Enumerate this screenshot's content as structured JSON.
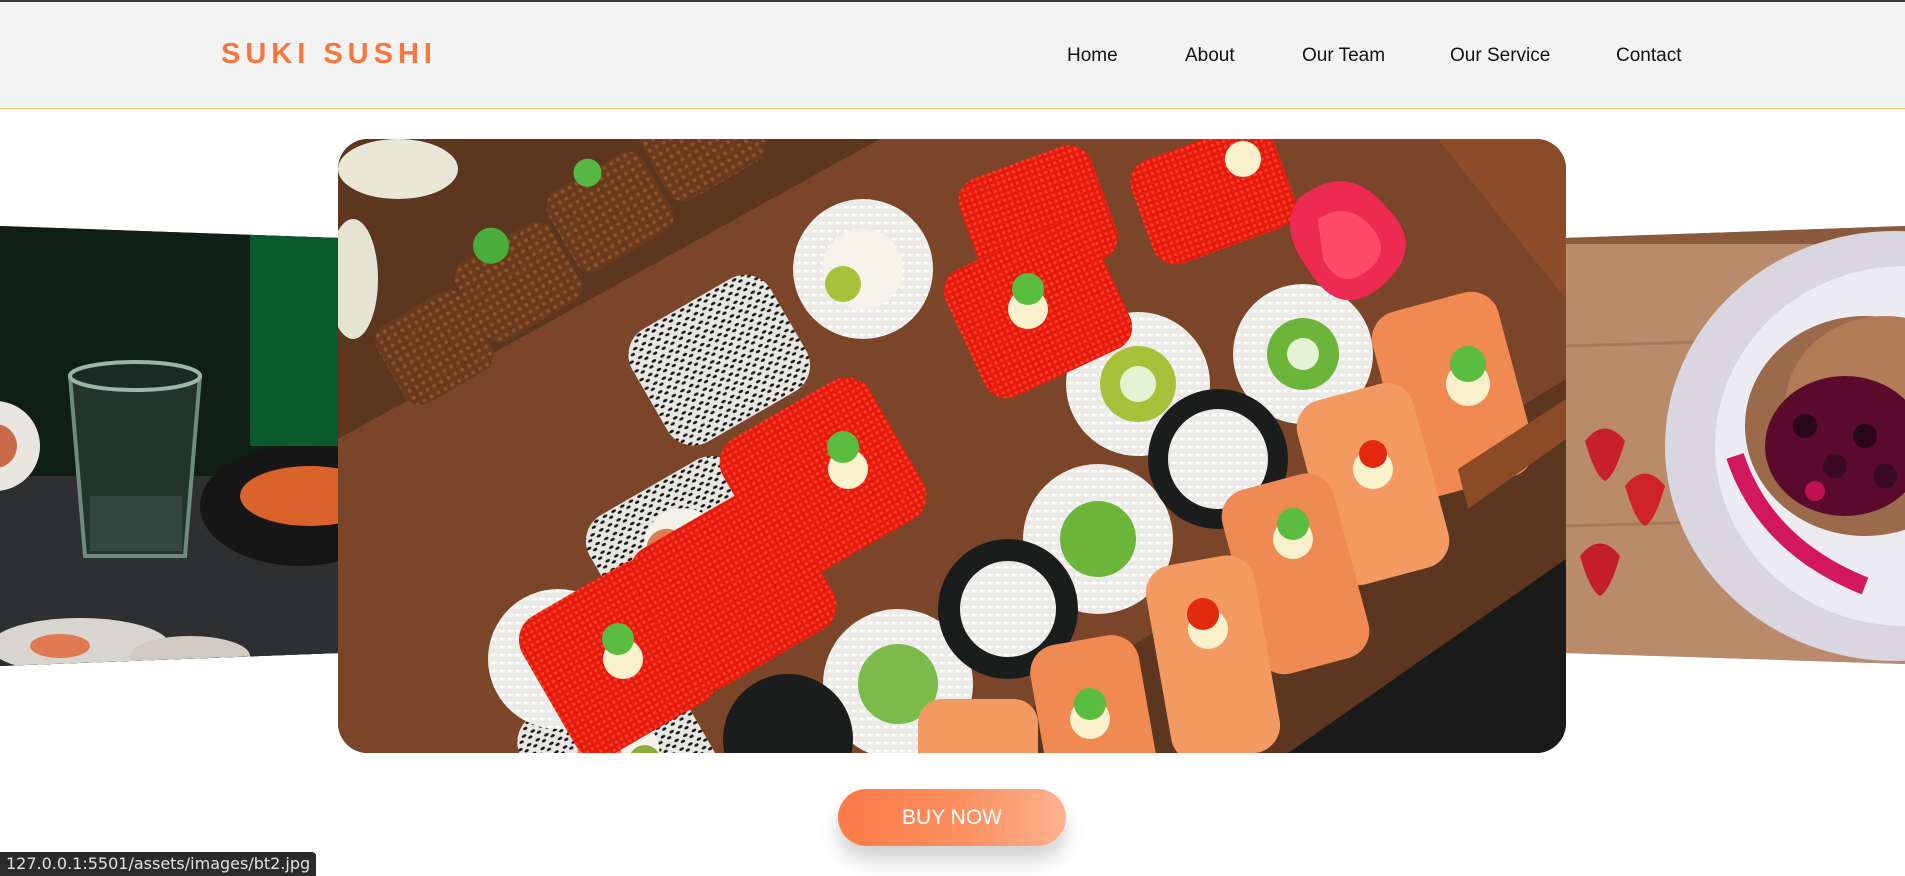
{
  "header": {
    "logo": "SUKI SUSHI",
    "nav": [
      "Home",
      "About",
      "Our Team",
      "Our Service",
      "Contact"
    ]
  },
  "carousel": {
    "slides": [
      {
        "name": "left-slide",
        "content": "sushi-with-drink"
      },
      {
        "name": "main-slide",
        "content": "sushi-platter"
      },
      {
        "name": "right-slide",
        "content": "pancakes-with-berries"
      }
    ]
  },
  "cta": {
    "label": "BUY NOW"
  },
  "statusbar": {
    "url": "127.0.0.1:5501/assets/images/bt2.jpg"
  },
  "colors": {
    "accent": "#f7763e",
    "header_bg": "#f3f3f4",
    "header_border": "#f7c46a"
  }
}
